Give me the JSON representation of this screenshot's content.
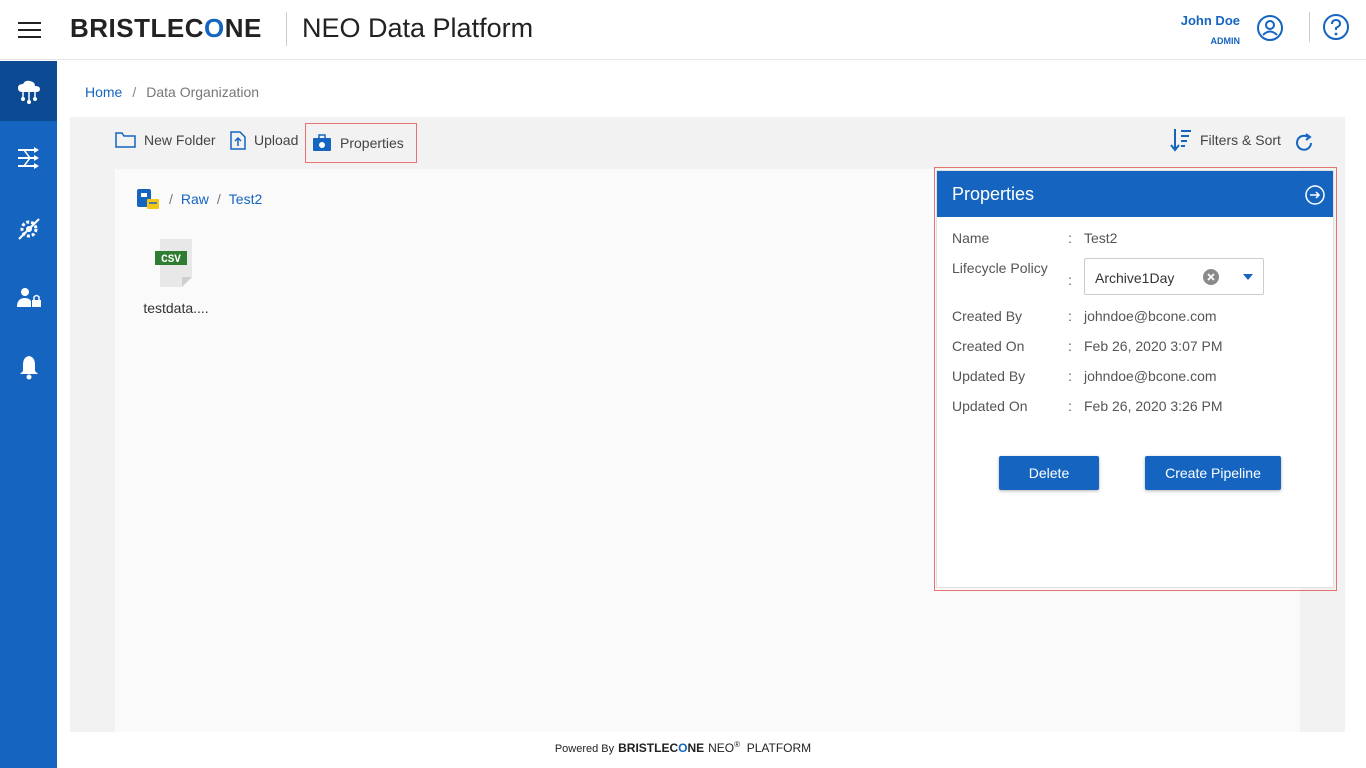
{
  "header": {
    "brand_pre": "BRISTLEC",
    "brand_o": "O",
    "brand_post": "NE",
    "app_title": "NEO Data Platform",
    "user_name": "John Doe",
    "user_role": "ADMIN"
  },
  "sidebar": {
    "items": [
      {
        "icon": "cloud-network-icon",
        "active": true
      },
      {
        "icon": "pipeline-icon",
        "active": false
      },
      {
        "icon": "gear-config-icon",
        "active": false
      },
      {
        "icon": "user-admin-icon",
        "active": false
      },
      {
        "icon": "bell-icon",
        "active": false
      }
    ]
  },
  "breadcrumb": {
    "home": "Home",
    "sep": "/",
    "current": "Data Organization"
  },
  "toolbar": {
    "new_folder": "New Folder",
    "upload": "Upload",
    "properties": "Properties",
    "filters_sort": "Filters & Sort"
  },
  "path": {
    "sep": "/",
    "raw": "Raw",
    "current": "Test2"
  },
  "files": [
    {
      "type_label": "CSV",
      "name": "testdata...."
    }
  ],
  "properties": {
    "title": "Properties",
    "colon": ":",
    "name_label": "Name",
    "name_value": "Test2",
    "lifecycle_label": "Lifecycle Policy",
    "lifecycle_value": "Archive1Day",
    "created_by_label": "Created By",
    "created_by_value": "johndoe@bcone.com",
    "created_on_label": "Created On",
    "created_on_value": "Feb 26, 2020 3:07 PM",
    "updated_by_label": "Updated By",
    "updated_by_value": "johndoe@bcone.com",
    "updated_on_label": "Updated On",
    "updated_on_value": "Feb 26, 2020 3:26 PM",
    "delete_label": "Delete",
    "create_pipeline_label": "Create Pipeline"
  },
  "footer": {
    "powered_by": "Powered By",
    "brand_pre": "BRISTLEC",
    "brand_o": "O",
    "brand_post": "NE",
    "neo": "NEO",
    "reg": "®",
    "platform": "PLATFORM"
  },
  "colors": {
    "primary": "#1565c0",
    "sidebar_active": "#0d4a94",
    "highlight": "#e57373"
  }
}
